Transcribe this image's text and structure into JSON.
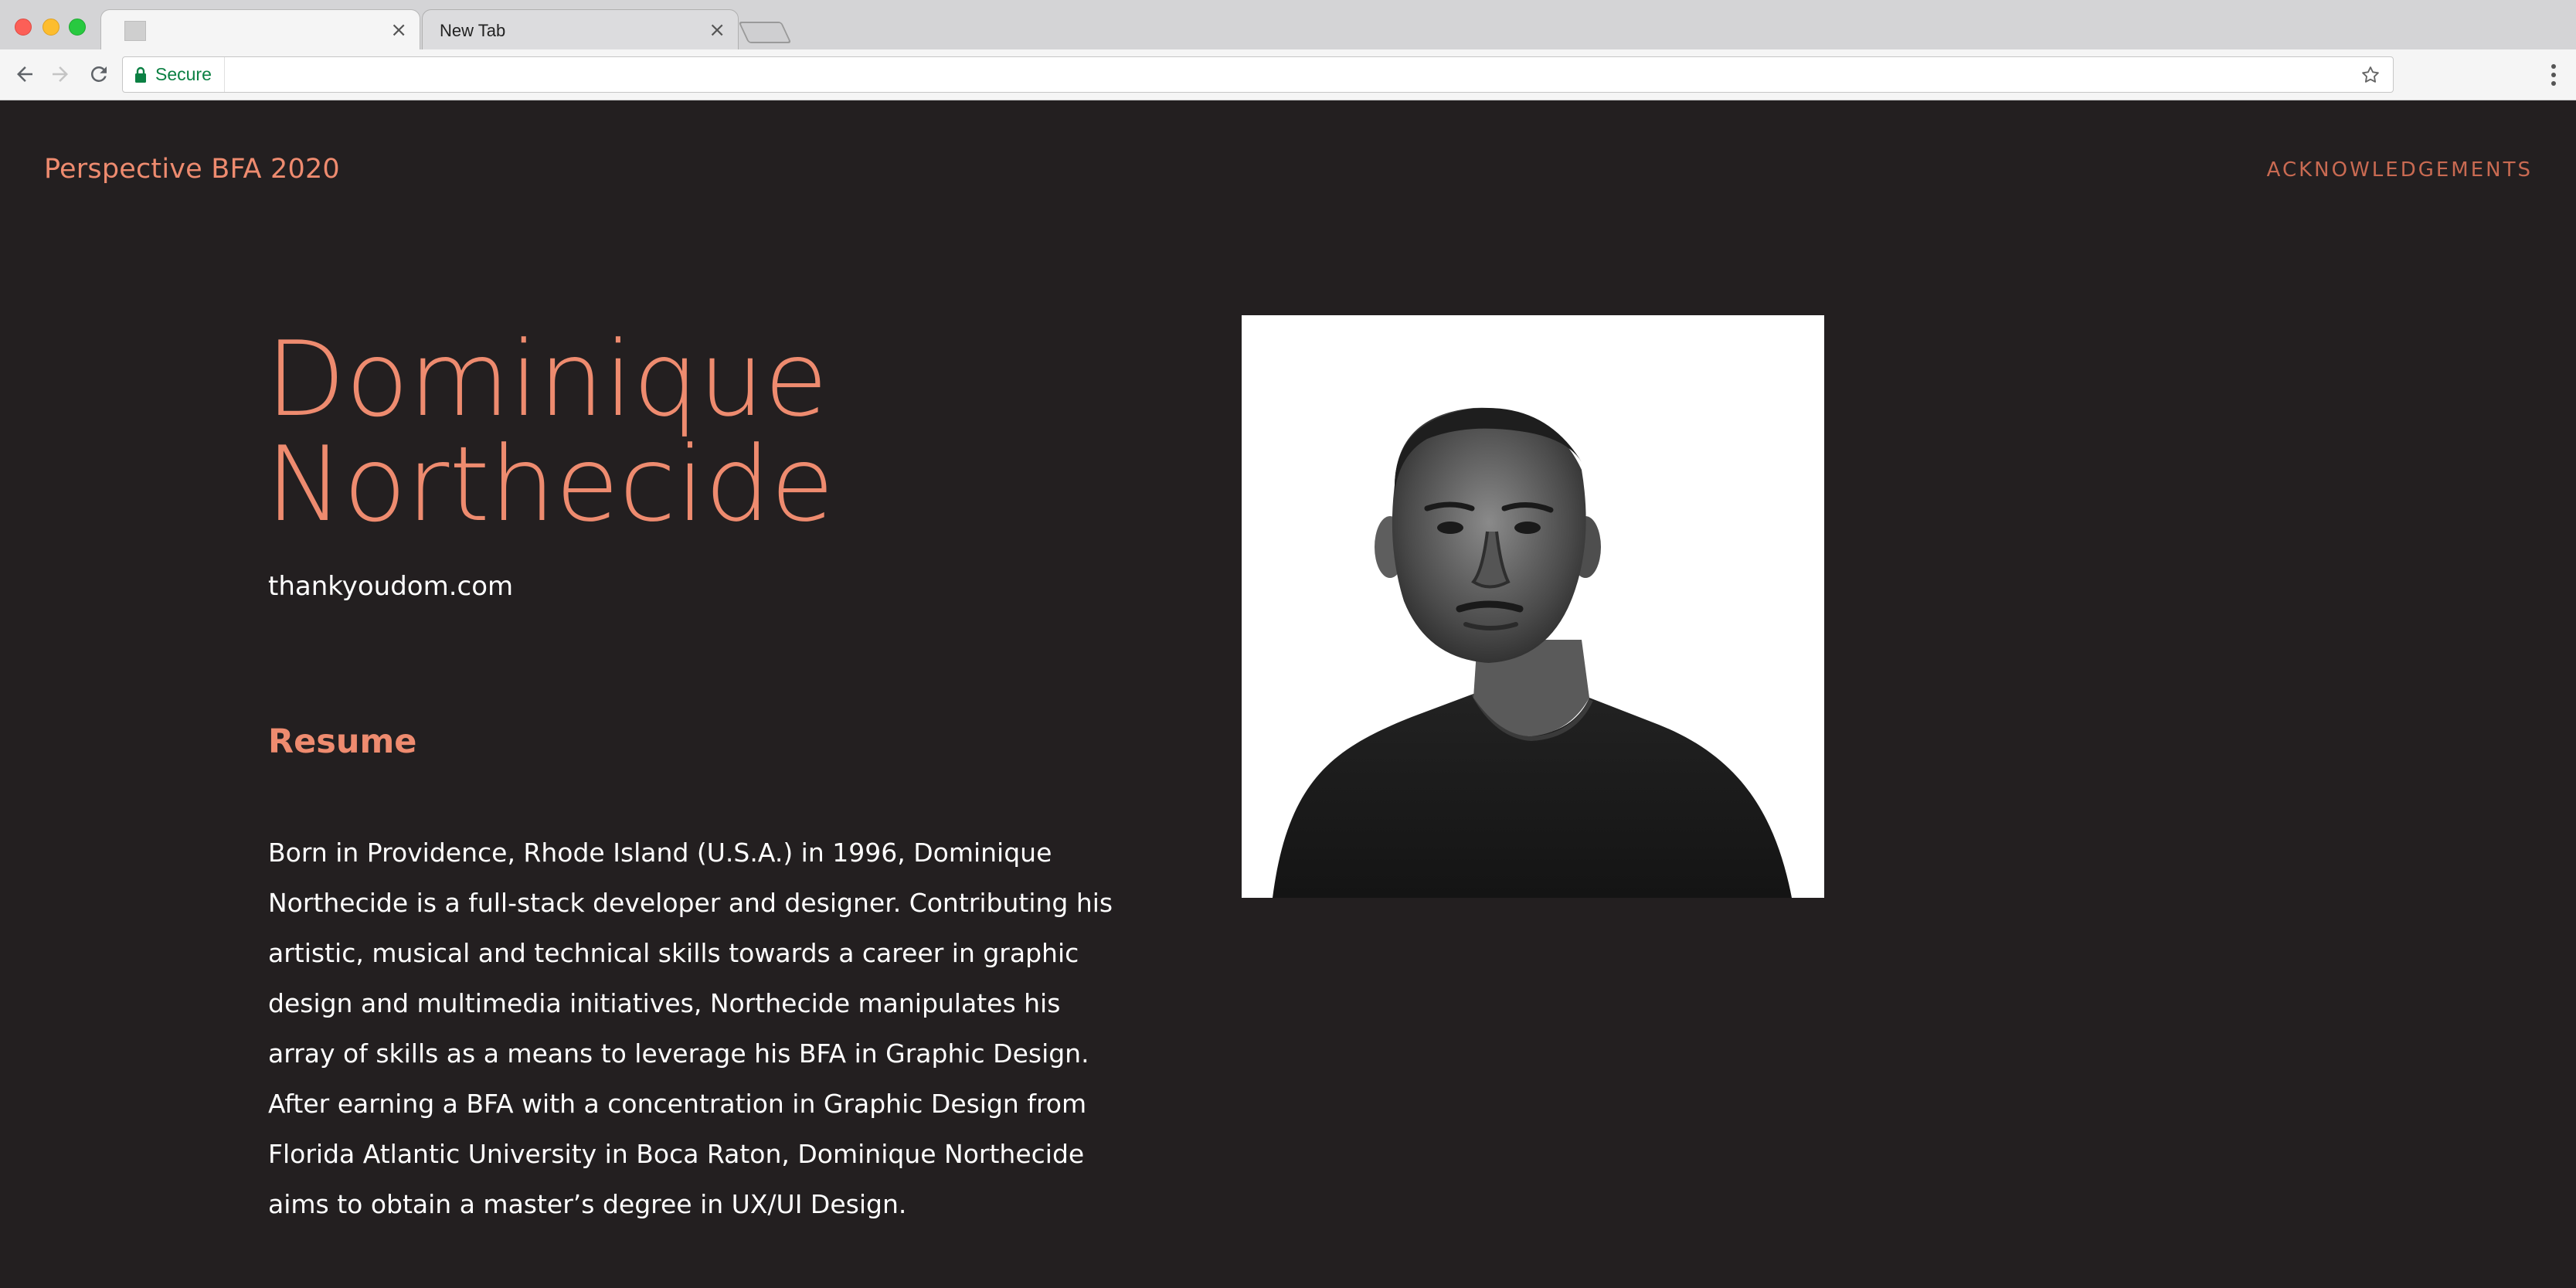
{
  "browser": {
    "tabs": [
      {
        "label": "",
        "active": true
      },
      {
        "label": "New Tab",
        "active": false
      }
    ],
    "address_bar": {
      "secure_label": "Secure",
      "url": ""
    }
  },
  "site": {
    "title": "Perspective BFA 2020",
    "nav": {
      "acknowledgements": "ACKNOWLEDGEMENTS"
    }
  },
  "profile": {
    "name_line1": "Dominique",
    "name_line2": "Northecide",
    "website": "thankyoudom.com",
    "resume_heading": "Resume",
    "bio_lines": [
      "Born in Providence, Rhode Island (U.S.A.) in 1996, Dominique",
      "Northecide is a full-stack developer and designer. Contributing his",
      "artistic, musical and technical skills towards a career in graphic",
      "design and multimedia initiatives, Northecide manipulates his",
      "array of skills as a means to leverage his BFA in Graphic Design.",
      "After earning a BFA with a concentration in Graphic Design from",
      "Florida Atlantic University in Boca Raton, Dominique Northecide",
      "aims to obtain a master’s degree in UX/UI Design."
    ]
  },
  "colors": {
    "accent": "#ee8b6f",
    "page_background": "#231f20",
    "text": "#ffffff"
  },
  "icons": {
    "back": "arrow-left-icon",
    "forward": "arrow-right-icon",
    "reload": "reload-icon",
    "lock": "lock-icon",
    "bookmark": "star-icon",
    "menu": "kebab-menu-icon",
    "tab_close": "close-icon"
  }
}
